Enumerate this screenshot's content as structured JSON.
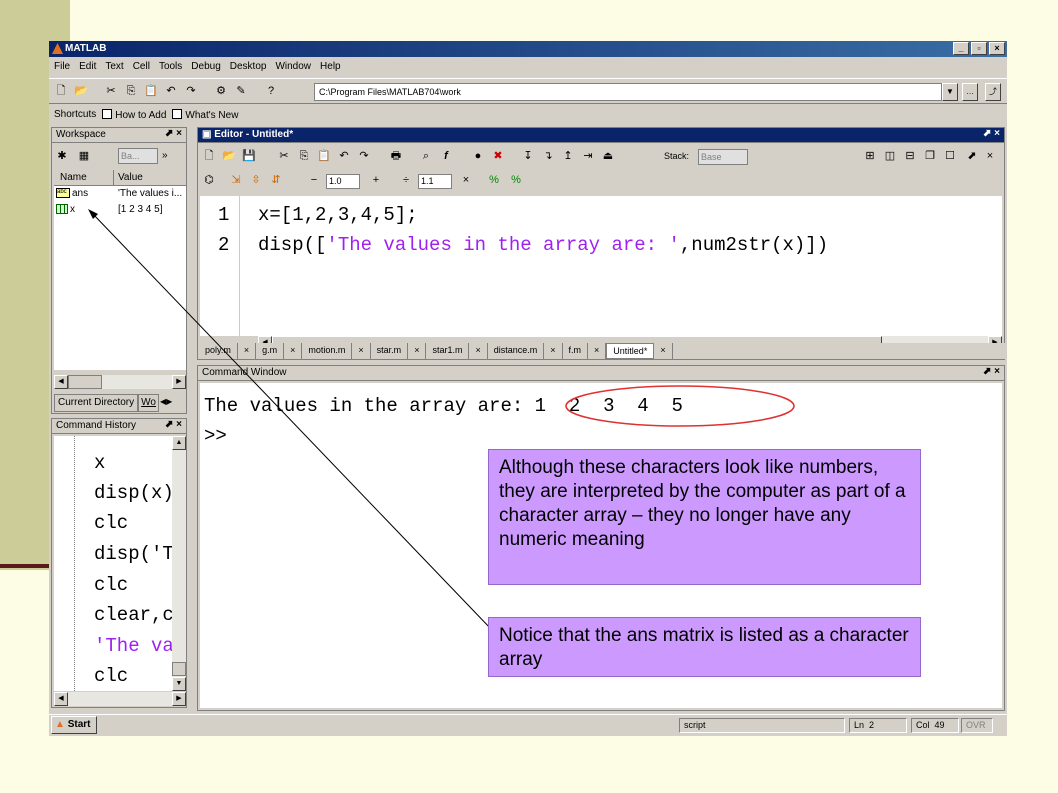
{
  "app_title": "MATLAB",
  "menu": [
    "File",
    "Edit",
    "Text",
    "Cell",
    "Tools",
    "Debug",
    "Desktop",
    "Window",
    "Help"
  ],
  "current_dir_path": "C:\\Program Files\\MATLAB704\\work",
  "shortcuts": {
    "label": "Shortcuts",
    "how_to_add": "How to Add",
    "whats_new": "What's New"
  },
  "workspace": {
    "title": "Workspace",
    "base_dropdown": "Ba...",
    "col_name": "Name",
    "col_value": "Value",
    "rows": [
      {
        "name": "ans",
        "value": "'The values i..."
      },
      {
        "name": "x",
        "value": "[1 2 3 4 5]"
      }
    ],
    "tab_current_dir": "Current Directory",
    "tab_other": "Wo"
  },
  "history": {
    "title": "Command History",
    "lines": [
      "x",
      "disp(x)",
      "clc",
      "disp('T",
      "clc",
      "clear,c",
      "'The va",
      "clc"
    ]
  },
  "editor": {
    "title": "Editor - Untitled*",
    "stack_label": "Stack:",
    "stack_value": "Base",
    "minus_value": "1.0",
    "div_value": "1.1",
    "lines": [
      {
        "num": "1",
        "code": "x=[1,2,3,4,5];",
        "string": ""
      },
      {
        "num": "2",
        "code_pre": "disp([",
        "string": "'The values in the array are: '",
        "code_post": ",num2str(x)])"
      }
    ],
    "tabs": [
      "poly.m",
      "g.m",
      "motion.m",
      "star.m",
      "star1.m",
      "distance.m",
      "f.m",
      "Untitled*"
    ]
  },
  "command_window": {
    "title": "Command Window",
    "output": "The values in the array are: 1  2  3  4  5",
    "prompt": ">>"
  },
  "callouts": {
    "first": "Although these characters look like numbers, they are interpreted by the computer as part of a character array – they no longer have any numeric meaning",
    "second": "Notice that the ans matrix is listed as a character array"
  },
  "status": {
    "start": "Start",
    "mode": "script",
    "ln_label": "Ln",
    "ln": "2",
    "col_label": "Col",
    "col": "49",
    "ovr": "OVR"
  }
}
